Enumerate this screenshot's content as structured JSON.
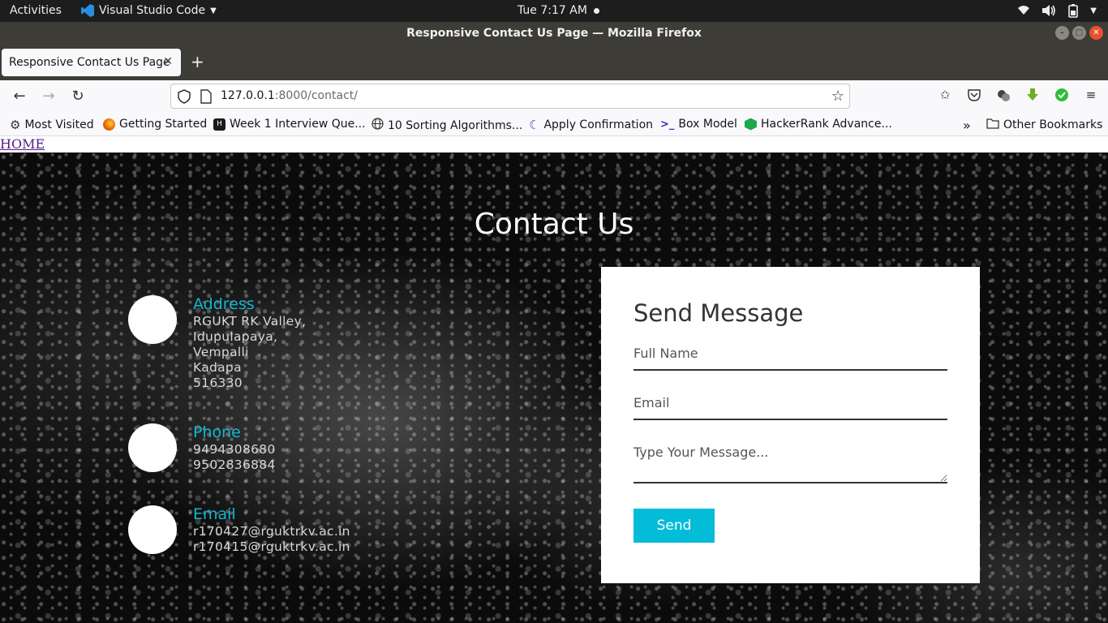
{
  "topbar": {
    "activities": "Activities",
    "app_name": "Visual Studio Code",
    "clock": "Tue  7:17 AM"
  },
  "window": {
    "title": "Responsive Contact Us Page — Mozilla Firefox"
  },
  "tabs": [
    {
      "label": "Responsive Contact Us Page"
    }
  ],
  "urlbar": {
    "host": "127.0.0.1",
    "path": ":8000/contact/"
  },
  "bookmarks": {
    "items": [
      {
        "label": "Most Visited",
        "icon": "gear-icon",
        "color": "#333333"
      },
      {
        "label": "Getting Started",
        "icon": "firefox-icon",
        "color": "#e66000"
      },
      {
        "label": "Week 1 Interview Que...",
        "icon": "hackerearth-icon",
        "color": "#1a1a1a"
      },
      {
        "label": "10 Sorting Algorithms...",
        "icon": "globe-icon",
        "color": "#333333"
      },
      {
        "label": "Apply Confirmation",
        "icon": "moon-icon",
        "color": "#3a49c9"
      },
      {
        "label": "Box Model",
        "icon": "prompt-icon",
        "color": "#3a2fb5"
      },
      {
        "label": "HackerRank Advance...",
        "icon": "hackerrank-icon",
        "color": "#1ba94c"
      }
    ],
    "other": "Other Bookmarks"
  },
  "page": {
    "home_link": "HOME",
    "title": "Contact Us",
    "info": [
      {
        "heading": "Address",
        "lines": [
          "RGUKT RK Valley,",
          "Idupulapaya,",
          "Vempalli",
          "Kadapa",
          "516330"
        ]
      },
      {
        "heading": "Phone",
        "lines": [
          "9494308680",
          "9502836884"
        ]
      },
      {
        "heading": "Email",
        "lines": [
          "r170427@rguktrkv.ac.in",
          "r170415@rguktrkv.ac.in"
        ]
      }
    ],
    "form": {
      "heading": "Send Message",
      "fullname_placeholder": "Full Name",
      "email_placeholder": "Email",
      "message_placeholder": "Type Your Message...",
      "send_label": "Send"
    },
    "colors": {
      "accent": "#03bcd8"
    }
  }
}
